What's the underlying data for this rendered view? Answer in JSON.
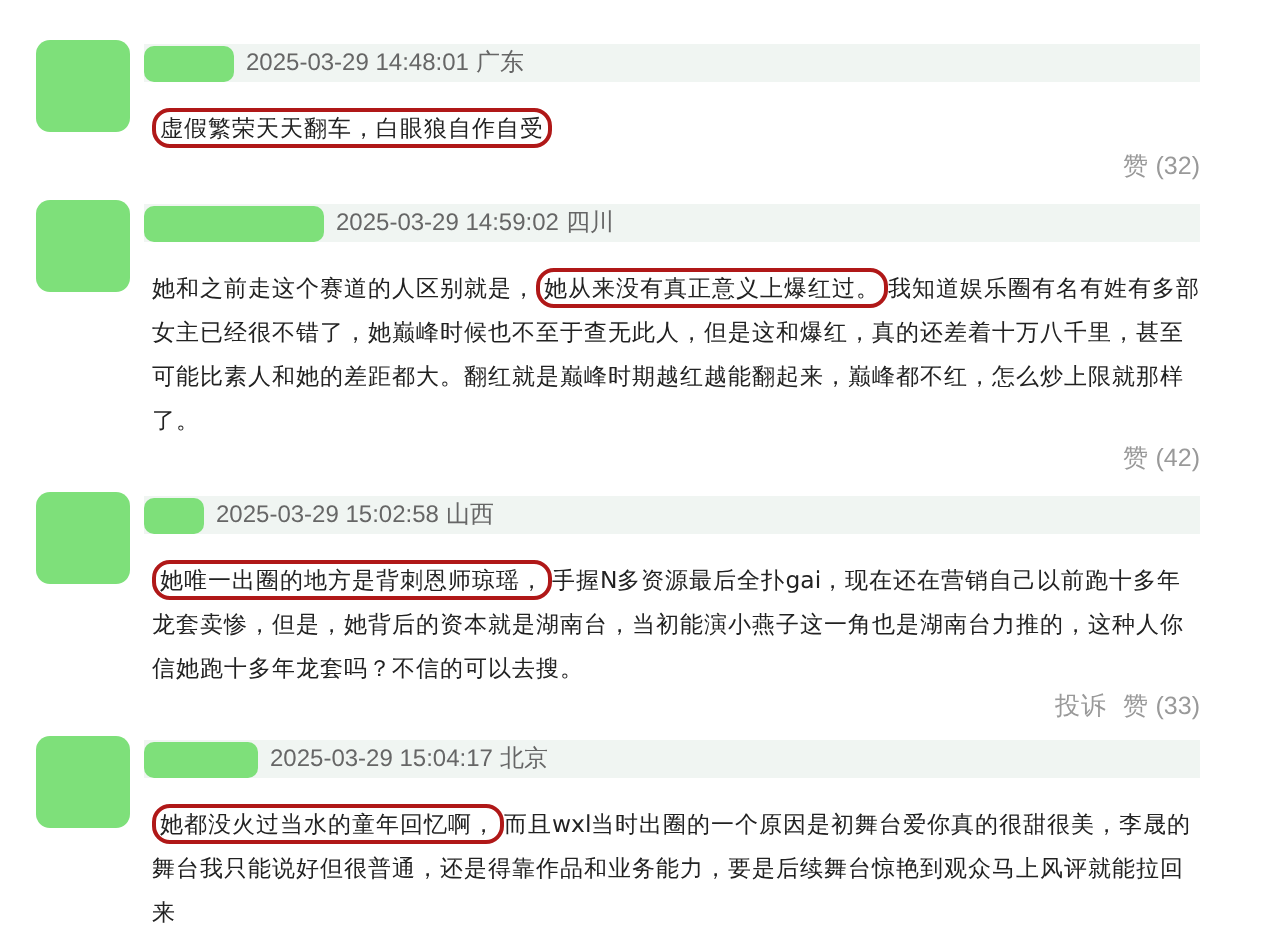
{
  "comments": [
    {
      "time": "2025-03-29 14:48:01",
      "location": "广东",
      "parts": [
        {
          "text": "虚假繁荣天天翻车，白眼狼自作自受",
          "highlighted": true
        }
      ],
      "actions": [
        "赞 (32)"
      ]
    },
    {
      "time": "2025-03-29 14:59:02",
      "location": "四川",
      "parts": [
        {
          "text": "她和之前走这个赛道的人区别就是，",
          "highlighted": false
        },
        {
          "text": "她从来没有真正意义上爆红过。",
          "highlighted": true
        },
        {
          "text": "我知道娱乐圈有名有姓有多部女主已经很不错了，她巅峰时候也不至于查无此人，但是这和爆红，真的还差着十万八千里，甚至可能比素人和她的差距都大。翻红就是巅峰时期越红越能翻起来，巅峰都不红，怎么炒上限就那样了。",
          "highlighted": false
        }
      ],
      "actions": [
        "赞 (42)"
      ]
    },
    {
      "time": "2025-03-29 15:02:58",
      "location": "山西",
      "parts": [
        {
          "text": "她唯一出圈的地方是背刺恩师琼瑶，",
          "highlighted": true
        },
        {
          "text": "手握N多资源最后全扑gai，现在还在营销自己以前跑十多年龙套卖惨，但是，她背后的资本就是湖南台，当初能演小燕子这一角也是湖南台力推的，这种人你信她跑十多年龙套吗？不信的可以去搜。",
          "highlighted": false
        }
      ],
      "actions": [
        "投诉",
        "赞 (33)"
      ]
    },
    {
      "time": "2025-03-29 15:04:17",
      "location": "北京",
      "parts": [
        {
          "text": "她都没火过当水的童年回忆啊，",
          "highlighted": true
        },
        {
          "text": "而且wxl当时出圈的一个原因是初舞台爱你真的很甜很美，李晟的舞台我只能说好但很普通，还是得靠作品和业务能力，要是后续舞台惊艳到观众马上风评就能拉回来",
          "highlighted": false
        }
      ]
    }
  ]
}
